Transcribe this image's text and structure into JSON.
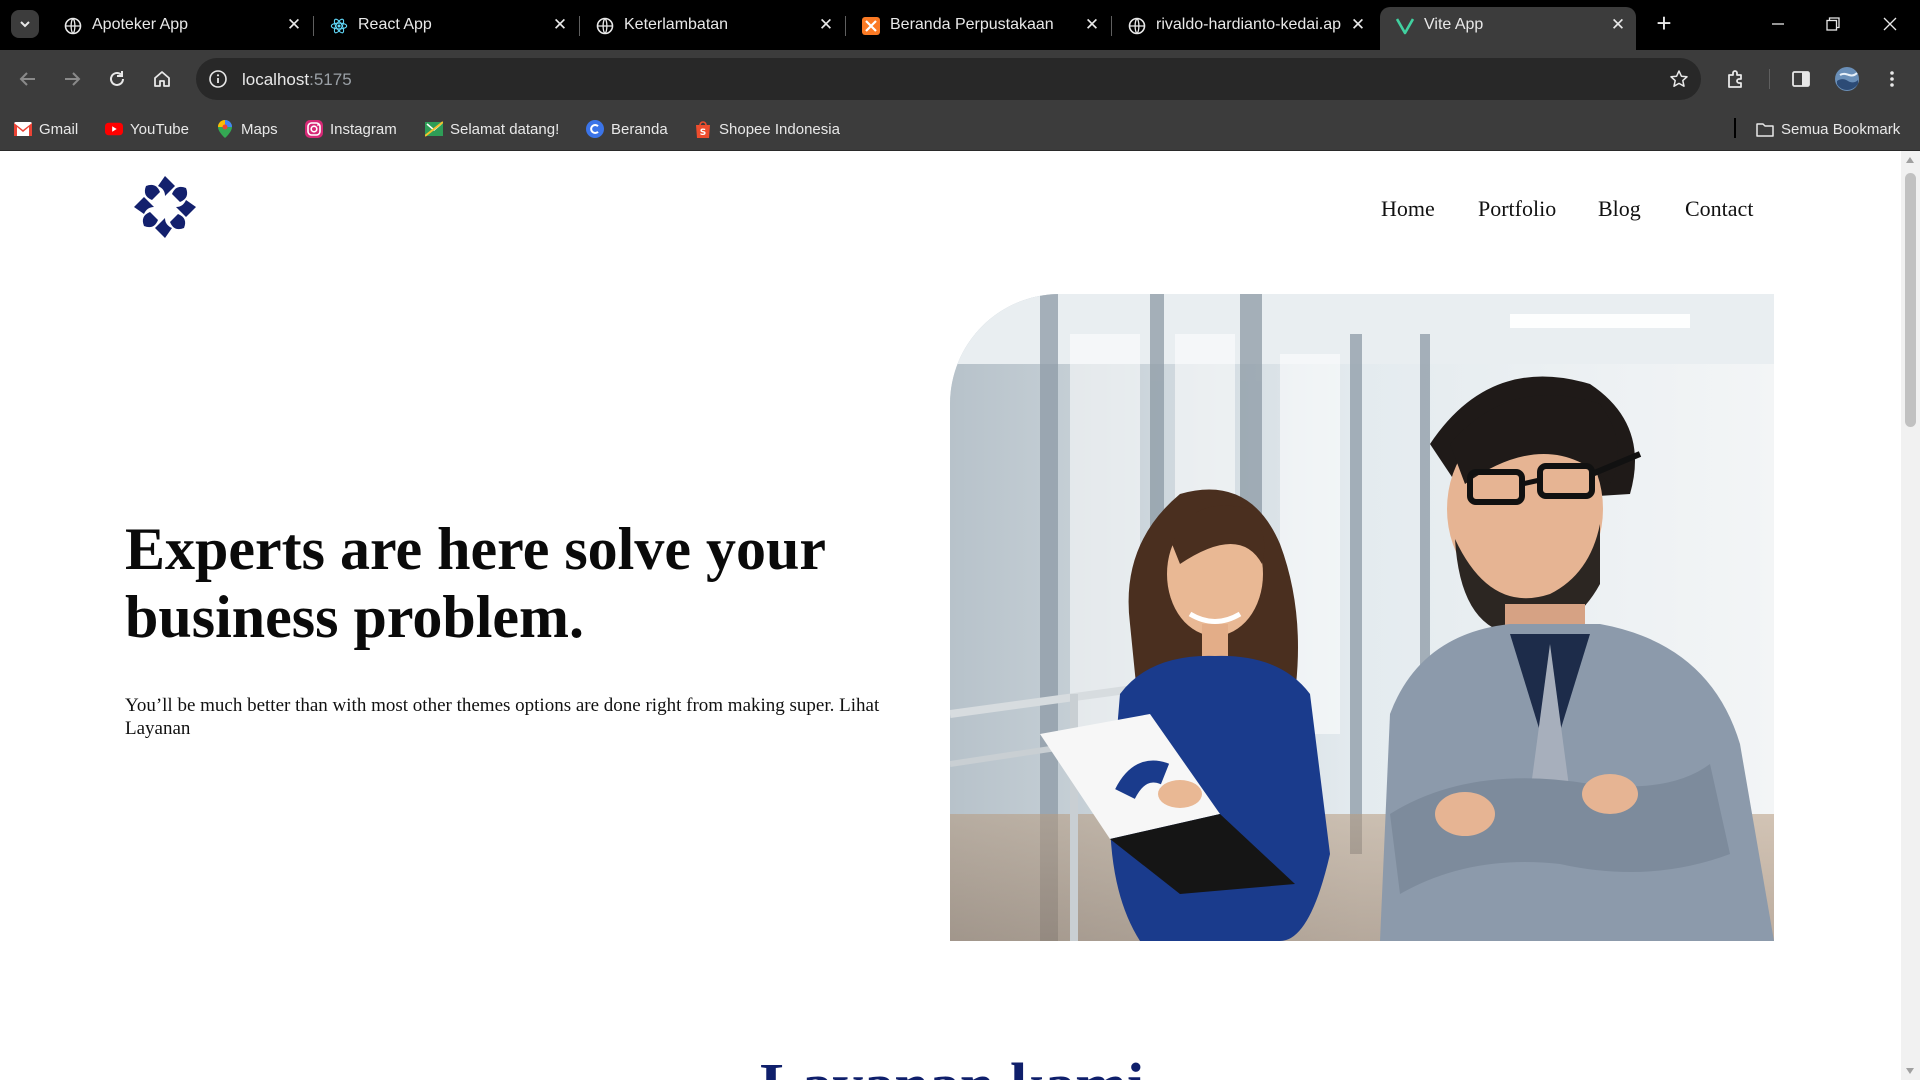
{
  "browser": {
    "tabs": [
      {
        "title": "Apoteker App",
        "icon": "globe-icon"
      },
      {
        "title": "React App",
        "icon": "react-icon"
      },
      {
        "title": "Keterlambatan",
        "icon": "globe-icon"
      },
      {
        "title": "Beranda Perpustakaan",
        "icon": "xampp-icon"
      },
      {
        "title": "rivaldo-hardianto-kedai.ap",
        "icon": "globe-icon"
      },
      {
        "title": "Vite App",
        "icon": "vite-icon",
        "active": true
      }
    ],
    "address": {
      "host": "localhost",
      "port": ":5175"
    },
    "bookmarks": [
      {
        "label": "Gmail",
        "icon": "gmail-icon"
      },
      {
        "label": "YouTube",
        "icon": "youtube-icon"
      },
      {
        "label": "Maps",
        "icon": "maps-icon"
      },
      {
        "label": "Instagram",
        "icon": "instagram-icon"
      },
      {
        "label": "Selamat datang!",
        "icon": "kemendikbud-icon"
      },
      {
        "label": "Beranda",
        "icon": "canva-icon"
      },
      {
        "label": "Shopee Indonesia",
        "icon": "shopee-icon"
      }
    ],
    "all_bookmarks": "Semua Bookmark",
    "colors": {
      "frame": "#000000",
      "toolbar": "#3c3c3c",
      "omnibox": "#282828",
      "text": "#e8e8e8"
    }
  },
  "site": {
    "nav": [
      "Home",
      "Portfolio",
      "Blog",
      "Contact"
    ],
    "hero": {
      "title": "Experts are here solve your business problem.",
      "subtitle": "You’ll be much better than with most other themes options are done right from making super. Lihat Layanan"
    },
    "next_section_heading": "Layanan kami",
    "colors": {
      "logo": "#13206d",
      "heading_blue": "#0f1f6b",
      "text": "#0a0a0a"
    }
  }
}
